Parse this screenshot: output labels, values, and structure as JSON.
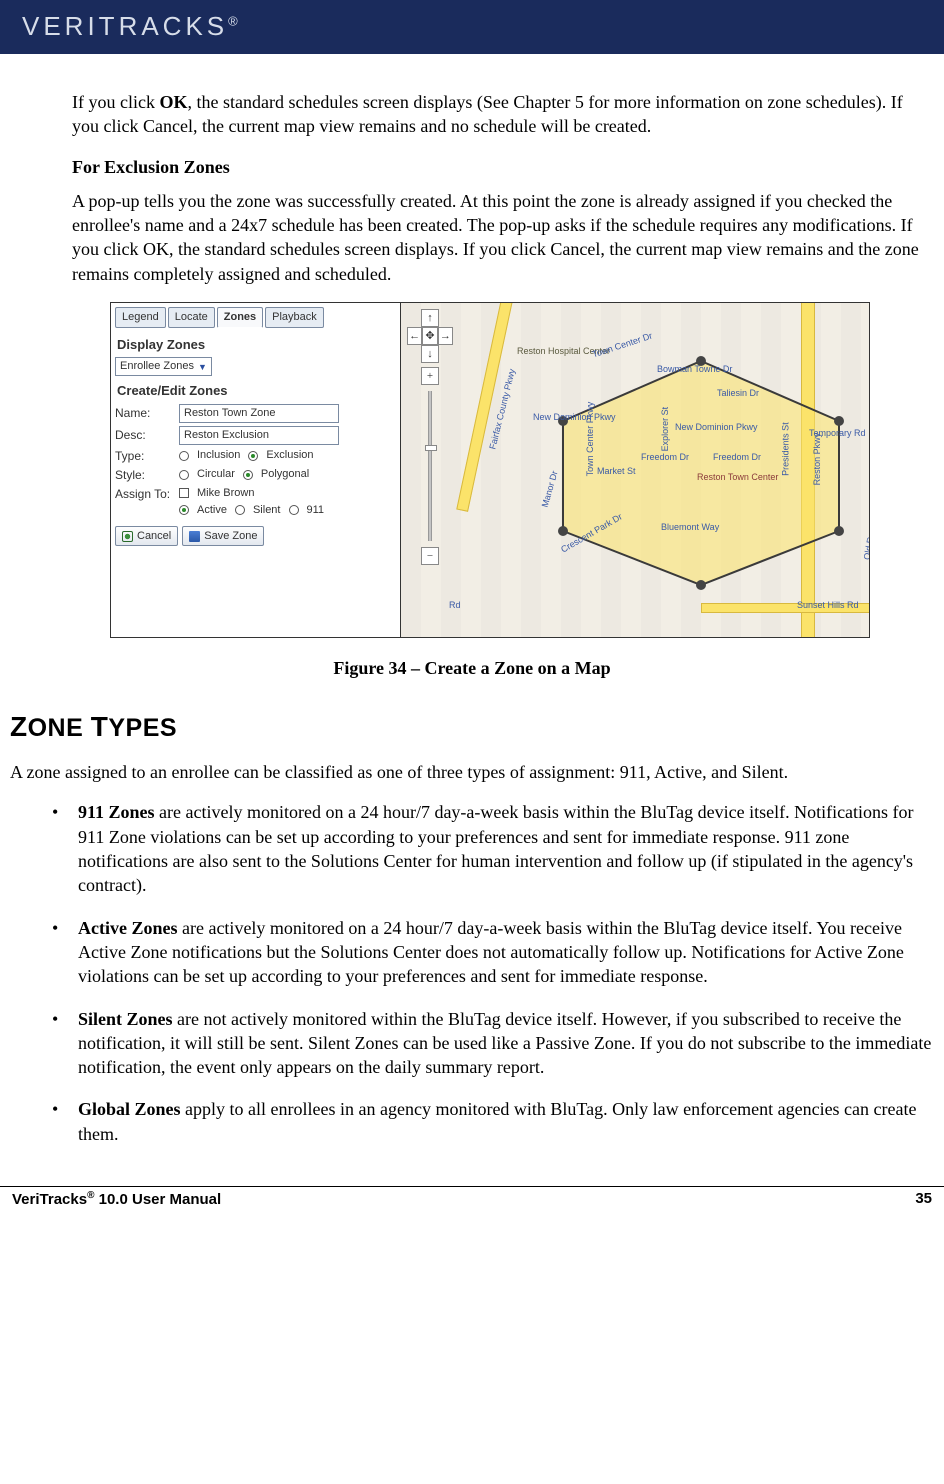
{
  "header": {
    "brand": "VERITRACKS",
    "reg": "®"
  },
  "para1_pre": "If you click ",
  "para1_bold": "OK",
  "para1_post": ", the standard schedules screen displays (See Chapter 5 for more information on zone schedules). If you click Cancel, the current map view remains and no schedule will be created.",
  "subhead1": "For Exclusion Zones",
  "para2": "A pop-up tells you the zone was successfully created.  At this point the zone is already assigned if you checked the enrollee's name and a 24x7 schedule has been created.  The pop-up asks if the schedule requires any modifications.  If you click OK, the standard schedules screen displays.  If you click Cancel, the current map view remains and the zone remains completely assigned and scheduled.",
  "figure": {
    "tabs": [
      "Legend",
      "Locate",
      "Zones",
      "Playback"
    ],
    "active_tab_index": 2,
    "display_zones_heading": "Display Zones",
    "display_zones_value": "Enrollee Zones",
    "create_edit_heading": "Create/Edit Zones",
    "name_label": "Name:",
    "name_value": "Reston Town Zone",
    "desc_label": "Desc:",
    "desc_value": "Reston Exclusion",
    "type_label": "Type:",
    "type_options": [
      "Inclusion",
      "Exclusion"
    ],
    "type_selected": "Exclusion",
    "style_label": "Style:",
    "style_options": [
      "Circular",
      "Polygonal"
    ],
    "style_selected": "Polygonal",
    "assign_label": "Assign To:",
    "assign_name": "Mike Brown",
    "assign_options": [
      "Active",
      "Silent",
      "911"
    ],
    "assign_selected": "Active",
    "cancel_btn": "Cancel",
    "save_btn": "Save Zone",
    "nav_up": "↑",
    "nav_down": "↓",
    "nav_left": "←",
    "nav_right": "→",
    "nav_center": "✥",
    "zoom_in": "+",
    "zoom_out": "−",
    "map_labels": {
      "reston_hospital": "Reston Hospital Center",
      "town_center_dr": "Town Center Dr",
      "bowman": "Bowman Towne Dr",
      "taliesin": "Taliesin Dr",
      "new_dominion": "New Dominion Pkwy",
      "new_dominion2": "New Dominion Pkwy",
      "freedom": "Freedom Dr",
      "freedom2": "Freedom Dr",
      "market": "Market St",
      "reston_town_center": "Reston Town Center",
      "bluemont": "Bluemont Way",
      "crescent": "Crescent Park Dr",
      "sunset": "Sunset Hills Rd",
      "fairfax": "Fairfax County Pkwy",
      "reston_pkwy": "Reston Pkwy",
      "explorer": "Explorer St",
      "presidents": "Presidents St",
      "temporary": "Temporary Rd",
      "old_reston": "Old Reston Ave",
      "rd": "Rd",
      "manor": "Manor Dr",
      "towncenter2": "Town Center Pkwy"
    }
  },
  "figure_caption": "Figure 34 – Create a Zone on a Map",
  "section_title": "ZONE TYPES",
  "section_intro": "A zone assigned to an enrollee can be classified as one of three types of assignment: 911, Active, and Silent.",
  "bullets": [
    {
      "term": "911 Zones",
      "text": " are actively monitored on a 24 hour/7 day-a-week basis within the BluTag device itself.  Notifications for 911 Zone violations can be set up according to your preferences and sent for immediate response. 911 zone notifications are also sent to the Solutions Center for human intervention and follow up (if stipulated in the agency's contract)."
    },
    {
      "term": "Active Zones",
      "text": " are actively monitored on a 24 hour/7 day-a-week basis within the BluTag device itself. You receive Active Zone notifications but the Solutions Center does not automatically follow up. Notifications for Active Zone violations can be set up according to your preferences and sent for immediate response."
    },
    {
      "term": "Silent Zones",
      "text": " are not actively monitored within the BluTag device itself. However, if you subscribed to receive the notification, it will still be sent. Silent Zones can be used like a Passive Zone. If you do not subscribe to the immediate notification, the event only appears on the daily summary report."
    },
    {
      "term": "Global Zones",
      "text": " apply to all enrollees in an agency monitored with BluTag. Only law enforcement agencies can create them."
    }
  ],
  "footer": {
    "left_a": "VeriTracks",
    "left_sup": "®",
    "left_b": " 10.0 User Manual",
    "right": "35"
  }
}
